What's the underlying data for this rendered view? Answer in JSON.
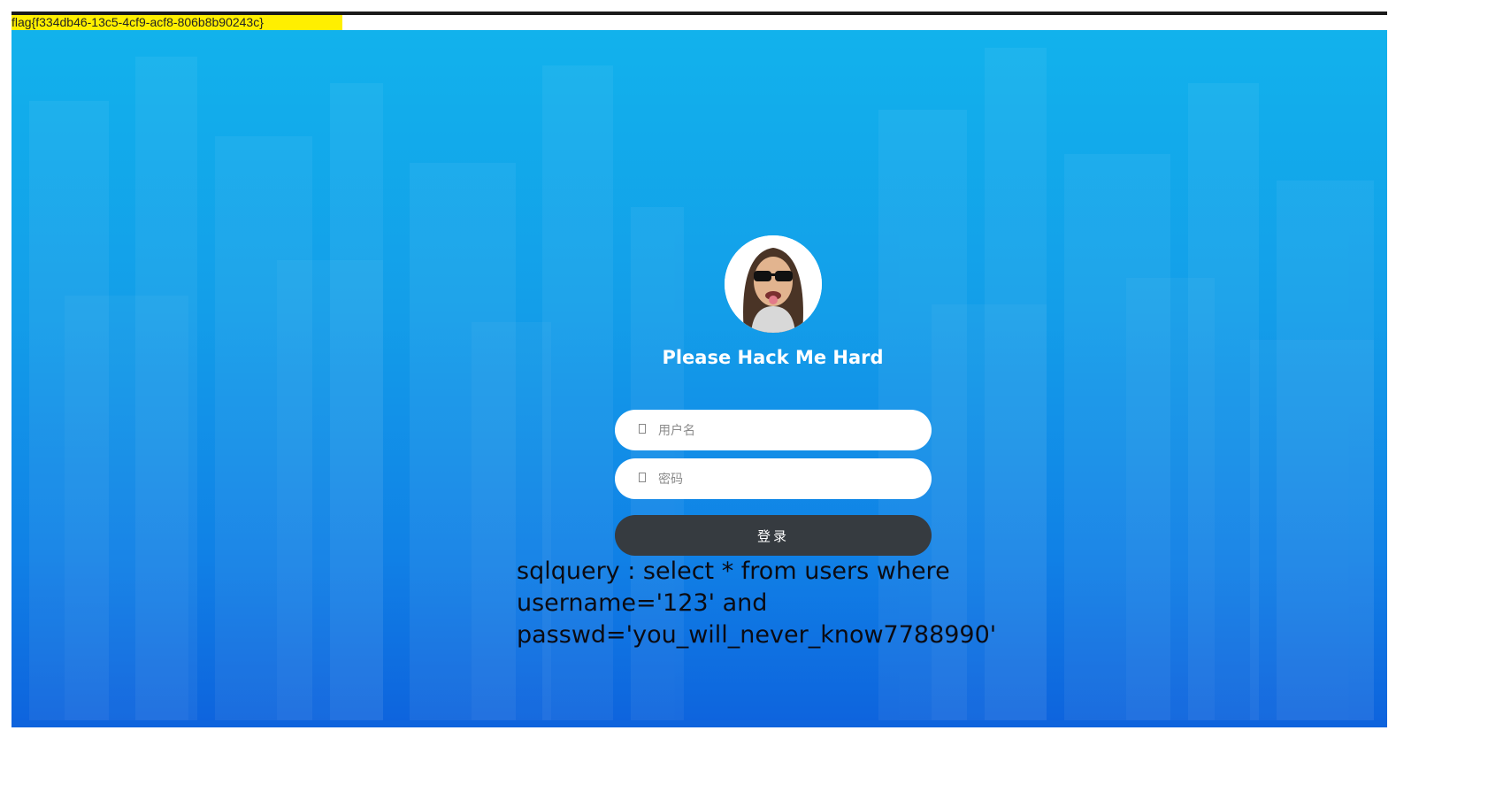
{
  "flag": {
    "text": "flag{f334db46-13c5-4cf9-acf8-806b8b90243c}"
  },
  "login": {
    "title": "Please Hack Me Hard",
    "username_placeholder": "用户名",
    "password_placeholder": "密码",
    "submit_label": "登录"
  },
  "sql": {
    "line1": "sqlquery : select * from users where",
    "line2": "username='123' and",
    "line3": "passwd='you_will_never_know7788990'"
  },
  "colors": {
    "flag_highlight": "#ffef00",
    "background_top": "#12b2ec",
    "background_bottom": "#0e63dd",
    "button": "#363b40"
  },
  "icons": {
    "avatar": "avatar-photo",
    "user_field_icon": "user-icon",
    "password_field_icon": "lock-icon"
  }
}
